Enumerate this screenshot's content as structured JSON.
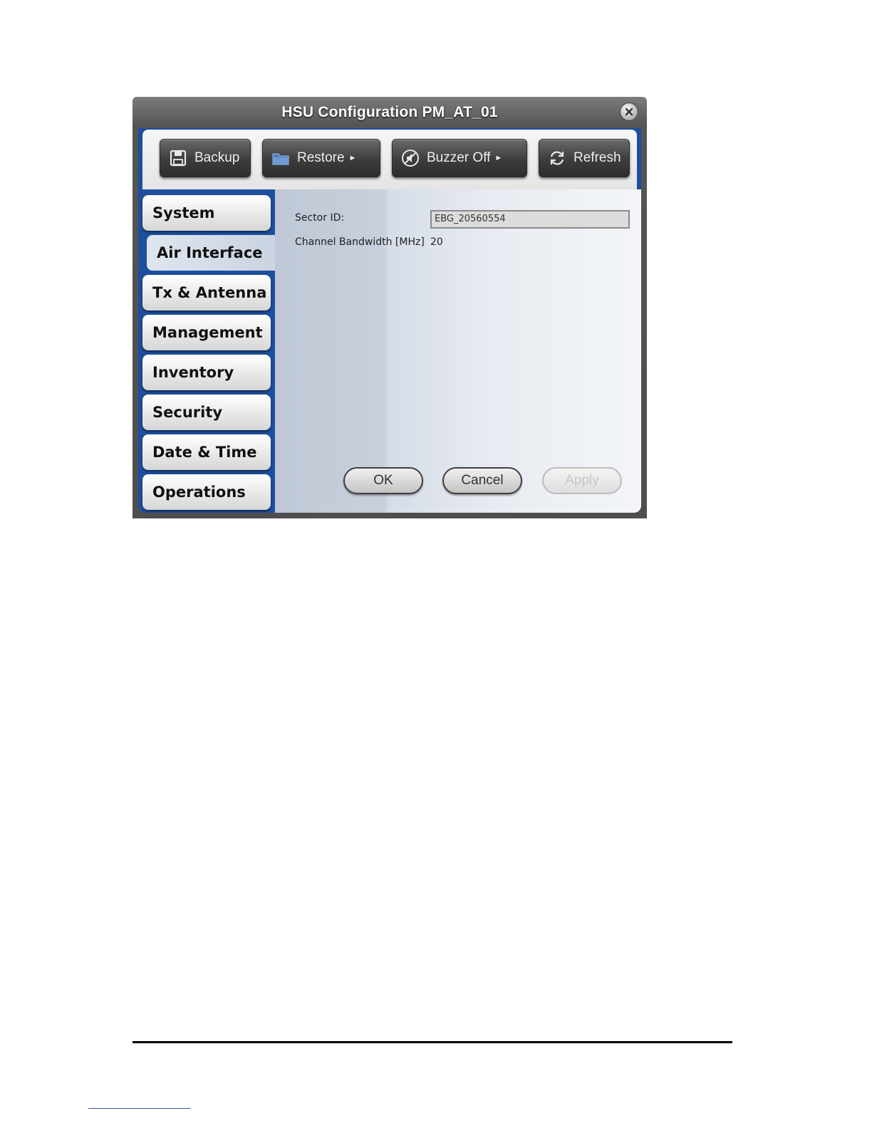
{
  "dialog": {
    "title": "HSU Configuration PM_AT_01"
  },
  "toolbar": {
    "backup_label": "Backup",
    "restore_label": "Restore",
    "buzzer_label": "Buzzer Off",
    "refresh_label": "Refresh",
    "icons": [
      "floppy-disk-icon",
      "folder-icon",
      "speaker-mute-icon",
      "refresh-icon"
    ]
  },
  "sidebar": {
    "items": [
      {
        "label": "System",
        "active": false
      },
      {
        "label": "Air Interface",
        "active": true
      },
      {
        "label": "Tx & Antenna",
        "active": false
      },
      {
        "label": "Management",
        "active": false
      },
      {
        "label": "Inventory",
        "active": false
      },
      {
        "label": "Security",
        "active": false
      },
      {
        "label": "Date & Time",
        "active": false
      },
      {
        "label": "Operations",
        "active": false
      }
    ]
  },
  "form": {
    "sector_id_label": "Sector ID:",
    "sector_id_value": "EBG_20560554",
    "channel_bandwidth_label": "Channel Bandwidth [MHz]",
    "channel_bandwidth_value": "20"
  },
  "actions": {
    "ok_label": "OK",
    "cancel_label": "Cancel",
    "apply_label": "Apply",
    "apply_enabled": false
  },
  "colors": {
    "frame_blue": "#1d4f9e",
    "toolbar_button": "#3c3c3c"
  }
}
